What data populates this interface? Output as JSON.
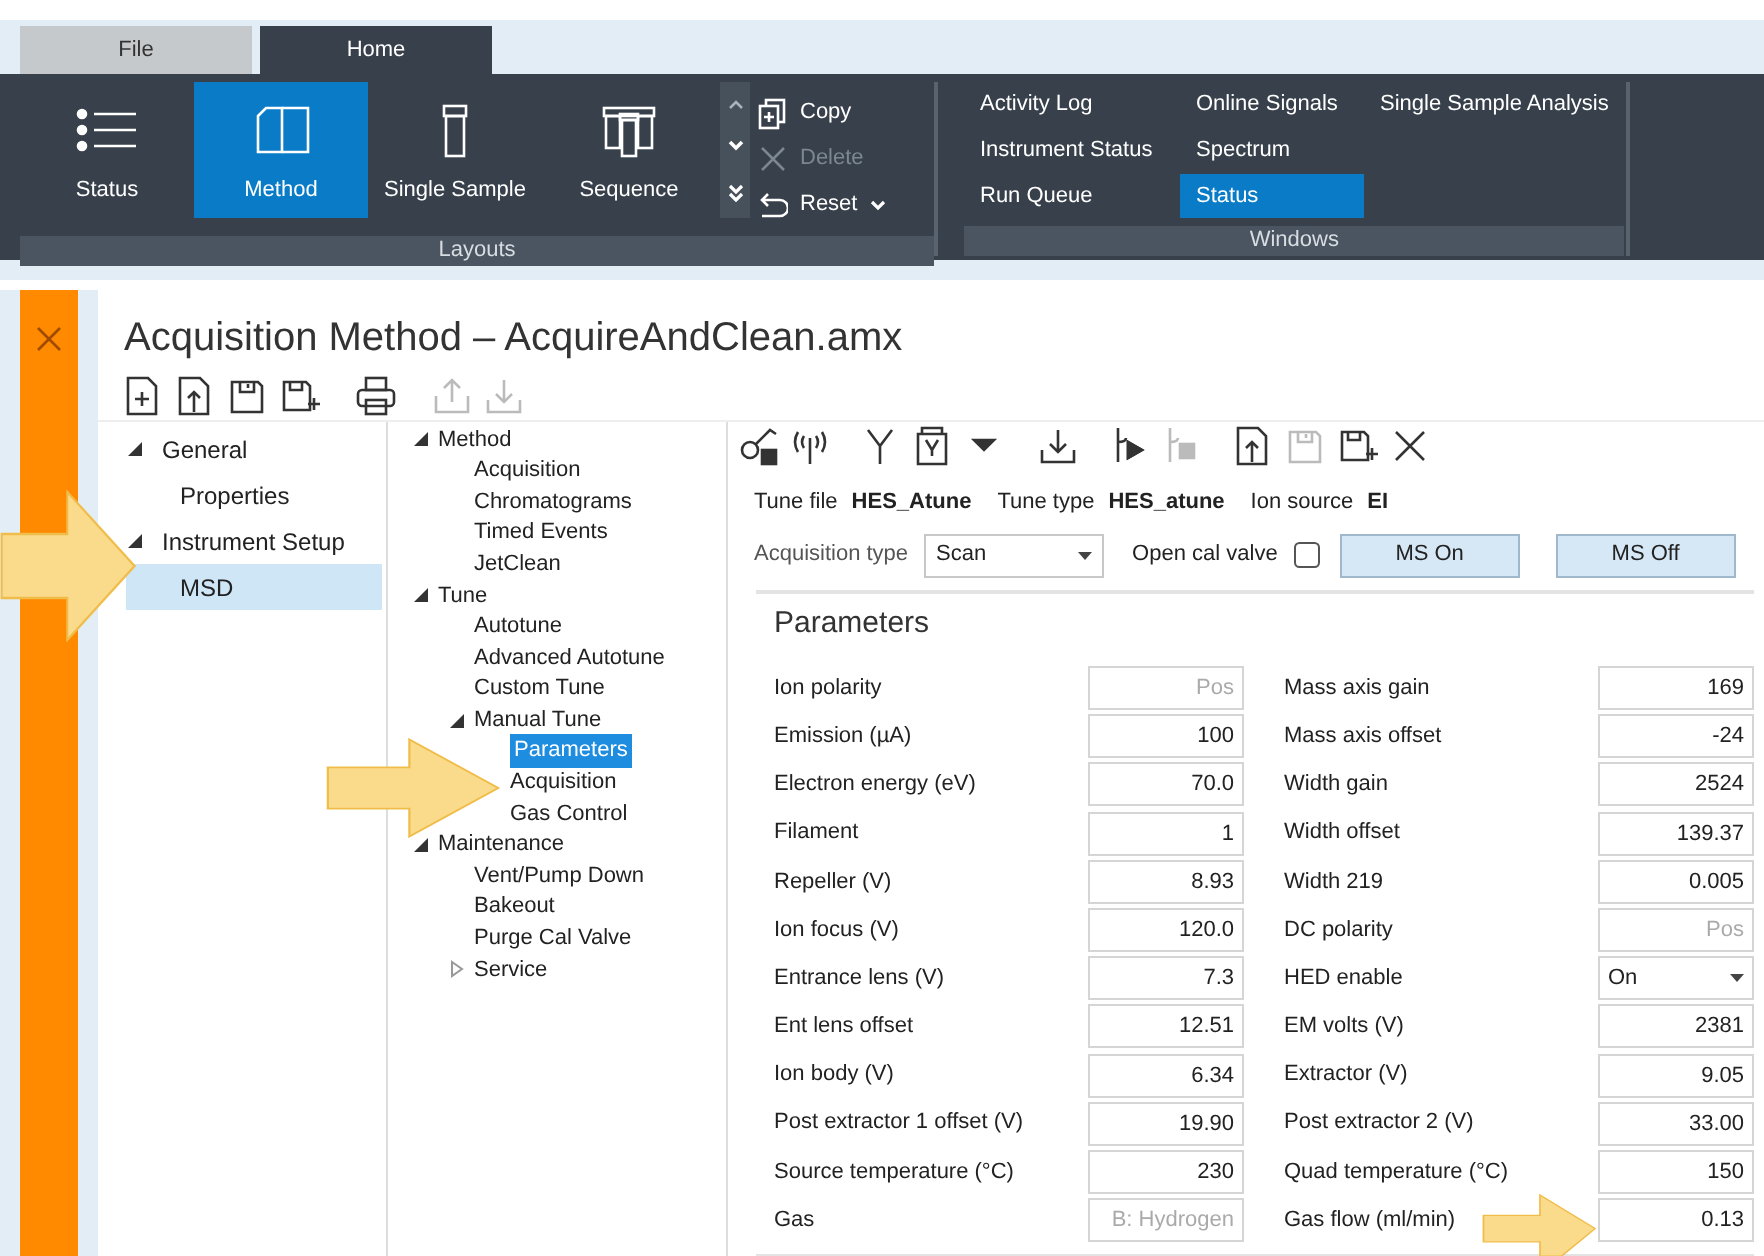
{
  "tabs": [
    {
      "label": "File",
      "selected": false
    },
    {
      "label": "Home",
      "selected": true
    }
  ],
  "ribbon": {
    "layouts": {
      "label": "Layouts",
      "buttons": [
        {
          "label": "Status",
          "kind": "list",
          "selected": false
        },
        {
          "label": "Method",
          "kind": "book",
          "selected": true
        },
        {
          "label": "Single Sample",
          "kind": "vial",
          "selected": false
        },
        {
          "label": "Sequence",
          "kind": "vials",
          "selected": false
        }
      ],
      "actions": [
        {
          "label": "Copy",
          "kind": "copy",
          "disabled": false,
          "dropdown": false
        },
        {
          "label": "Delete",
          "kind": "delete",
          "disabled": true,
          "dropdown": false
        },
        {
          "label": "Reset",
          "kind": "reset",
          "disabled": false,
          "dropdown": true
        }
      ]
    },
    "windows": {
      "label": "Windows",
      "items": [
        {
          "label": "Activity Log",
          "selected": false
        },
        {
          "label": "Instrument Status",
          "selected": false
        },
        {
          "label": "Run Queue",
          "selected": false
        },
        {
          "label": "Online Signals",
          "selected": false
        },
        {
          "label": "Spectrum",
          "selected": false
        },
        {
          "label": "Status",
          "selected": true
        },
        {
          "label": "Single Sample Analysis",
          "selected": false
        }
      ]
    }
  },
  "document": {
    "title": "Acquisition Method – AcquireAndClean.amx",
    "toolbar": [
      {
        "kind": "new",
        "disabled": false
      },
      {
        "kind": "open",
        "disabled": false
      },
      {
        "kind": "save",
        "disabled": false
      },
      {
        "kind": "save-as",
        "disabled": false
      },
      {
        "kind": "print",
        "disabled": false
      },
      {
        "kind": "upload",
        "disabled": true
      },
      {
        "kind": "download",
        "disabled": true
      }
    ],
    "nav_tree": [
      {
        "label": "General",
        "expanded": true,
        "selected": false,
        "children": [
          {
            "label": "Properties",
            "selected": false
          }
        ]
      },
      {
        "label": "Instrument Setup",
        "expanded": true,
        "selected": false,
        "children": [
          {
            "label": "MSD",
            "selected": true
          }
        ]
      }
    ],
    "section_tree": [
      {
        "label": "Method",
        "expanded": true,
        "selected": false,
        "children": [
          {
            "label": "Acquisition",
            "selected": false
          },
          {
            "label": "Chromatograms",
            "selected": false
          },
          {
            "label": "Timed Events",
            "selected": false
          },
          {
            "label": "JetClean",
            "selected": false
          }
        ]
      },
      {
        "label": "Tune",
        "expanded": true,
        "selected": false,
        "children": [
          {
            "label": "Autotune",
            "selected": false
          },
          {
            "label": "Advanced Autotune",
            "selected": false
          },
          {
            "label": "Custom Tune",
            "selected": false
          },
          {
            "label": "Manual Tune",
            "expanded": true,
            "selected": false,
            "children": [
              {
                "label": "Parameters",
                "selected": true
              },
              {
                "label": "Acquisition",
                "selected": false
              },
              {
                "label": "Gas Control",
                "selected": false
              }
            ]
          }
        ]
      },
      {
        "label": "Maintenance",
        "expanded": true,
        "selected": false,
        "children": [
          {
            "label": "Vent/Pump Down",
            "selected": false
          },
          {
            "label": "Bakeout",
            "selected": false
          },
          {
            "label": "Purge Cal Valve",
            "selected": false
          },
          {
            "label": "Service",
            "expanded": false,
            "selected": false
          }
        ]
      }
    ],
    "tools": [
      {
        "kind": "lock",
        "disabled": false
      },
      {
        "kind": "signal",
        "disabled": false
      },
      {
        "kind": "split",
        "disabled": false
      },
      {
        "kind": "vial-doc",
        "disabled": false
      },
      {
        "kind": "caret",
        "disabled": false
      },
      {
        "kind": "download",
        "disabled": false
      },
      {
        "kind": "run",
        "disabled": false
      },
      {
        "kind": "stop",
        "disabled": true
      },
      {
        "kind": "open",
        "disabled": false
      },
      {
        "kind": "save",
        "disabled": true
      },
      {
        "kind": "save-as",
        "disabled": false
      },
      {
        "kind": "close",
        "disabled": false
      }
    ],
    "info": [
      {
        "label": "Tune file",
        "value": "HES_Atune"
      },
      {
        "label": "Tune type",
        "value": "HES_atune"
      },
      {
        "label": "Ion source",
        "value": "EI"
      }
    ],
    "acquisition_type": {
      "label": "Acquisition type",
      "value": "Scan"
    },
    "open_cal_valve": {
      "label": "Open cal valve",
      "checked": false
    },
    "buttons": [
      "MS On",
      "MS Off"
    ],
    "parameters_title": "Parameters",
    "parameters": [
      {
        "label": "Ion polarity",
        "value": "Pos",
        "kind": "readonly"
      },
      {
        "label": "Mass axis gain",
        "value": "169",
        "kind": "input"
      },
      {
        "label": "Emission (µA)",
        "value": "100",
        "kind": "input"
      },
      {
        "label": "Mass axis offset",
        "value": "-24",
        "kind": "input"
      },
      {
        "label": "Electron energy (eV)",
        "value": "70.0",
        "kind": "input"
      },
      {
        "label": "Width gain",
        "value": "2524",
        "kind": "input"
      },
      {
        "label": "Filament",
        "value": "1",
        "kind": "input"
      },
      {
        "label": "Width offset",
        "value": "139.37",
        "kind": "input"
      },
      {
        "label": "Repeller (V)",
        "value": "8.93",
        "kind": "input"
      },
      {
        "label": "Width 219",
        "value": "0.005",
        "kind": "input"
      },
      {
        "label": "Ion focus (V)",
        "value": "120.0",
        "kind": "input"
      },
      {
        "label": "DC polarity",
        "value": "Pos",
        "kind": "readonly"
      },
      {
        "label": "Entrance lens (V)",
        "value": "7.3",
        "kind": "input"
      },
      {
        "label": "HED enable",
        "value": "On",
        "kind": "select"
      },
      {
        "label": "Ent lens offset",
        "value": "12.51",
        "kind": "input"
      },
      {
        "label": "EM volts (V)",
        "value": "2381",
        "kind": "input"
      },
      {
        "label": "Ion body (V)",
        "value": "6.34",
        "kind": "input"
      },
      {
        "label": "Extractor (V)",
        "value": "9.05",
        "kind": "input"
      },
      {
        "label": "Post extractor 1 offset (V)",
        "value": "19.90",
        "kind": "input"
      },
      {
        "label": "Post extractor 2 (V)",
        "value": "33.00",
        "kind": "input"
      },
      {
        "label": "Source temperature (°C)",
        "value": "230",
        "kind": "input"
      },
      {
        "label": "Quad temperature (°C)",
        "value": "150",
        "kind": "input"
      },
      {
        "label": "Gas",
        "value": "B: Hydrogen",
        "kind": "readonly"
      },
      {
        "label": "Gas flow (ml/min)",
        "value": "0.13",
        "kind": "input"
      }
    ]
  }
}
